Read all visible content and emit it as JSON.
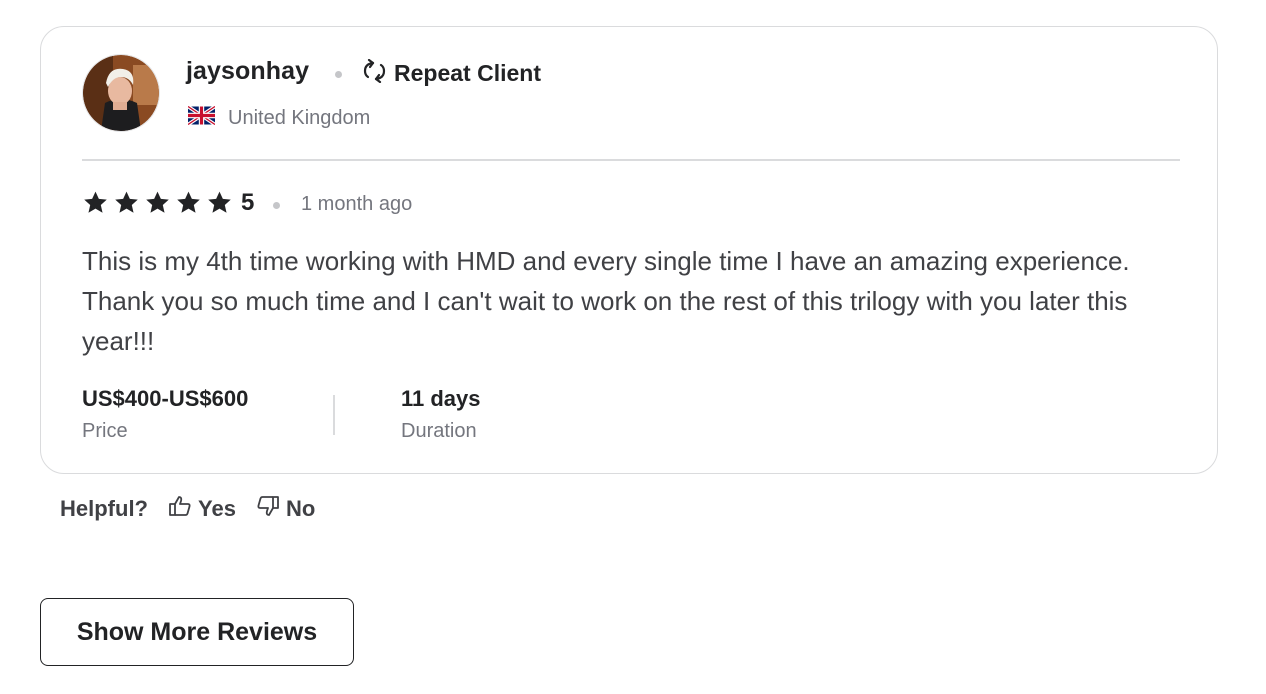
{
  "review": {
    "username": "jaysonhay",
    "badge_label": "Repeat Client",
    "badge_icon": "repeat-icon",
    "country": "United Kingdom",
    "country_flag_icon": "uk-flag-icon",
    "rating": "5",
    "stars_filled": 5,
    "stars_total": 5,
    "time_ago": "1 month ago",
    "text": "This is my 4th time working with HMD and every single time I have an amazing experience. Thank you so much time and I can't wait to work on the rest of this trilogy with you later this year!!!",
    "price_value": "US$400-US$600",
    "price_label": "Price",
    "duration_value": "11 days",
    "duration_label": "Duration"
  },
  "helpful": {
    "question": "Helpful?",
    "yes_label": "Yes",
    "no_label": "No"
  },
  "show_more_label": "Show More Reviews",
  "colors": {
    "text_dark": "#222325",
    "text_muted": "#74767e",
    "border": "#dadbdd"
  }
}
